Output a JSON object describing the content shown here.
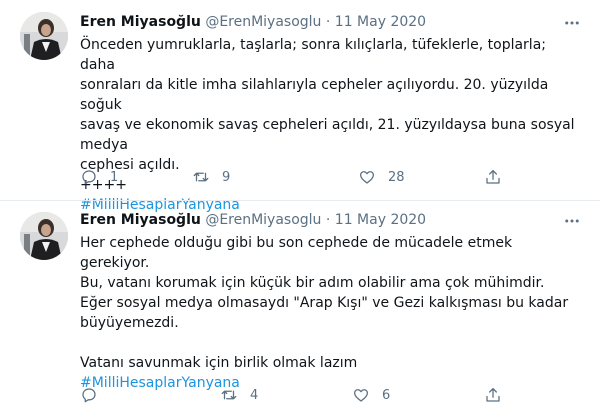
{
  "tweets": [
    {
      "display_name": "Eren Miyasoğlu",
      "handle": "@ErenMiyasoglu",
      "separator": "·",
      "date": "11 May 2020",
      "text": "Önceden yumruklarla, taşlarla; sonra kılıçlarla, tüfeklerle, toplarla; daha\nsonraları da kitle imha silahlarıyla cepheler açılıyordu. 20. yüzyılda soğuk\nsavaş ve ekonomik savaş cepheleri açıldı, 21. yüzyıldaysa buna sosyal medya\ncephesi açıldı.\n++++",
      "hashtag": "#MilliHesaplarYanyana",
      "reply_count": "1",
      "retweet_count": "9",
      "like_count": "28"
    },
    {
      "display_name": "Eren Miyasoğlu",
      "handle": "@ErenMiyasoglu",
      "separator": "·",
      "date": "11 May 2020",
      "text": "Her cephede olduğu gibi bu son cephede de mücadele etmek gerekiyor.\nBu, vatanı korumak için küçük bir adım olabilir ama çok mühimdir.\nEğer sosyal medya olmasaydı \"Arap Kışı\" ve Gezi kalkışması bu kadar\nbüyüyemezdi.\n\nVatanı savunmak için birlik olmak lazım",
      "hashtag": "#MilliHesaplarYanyana",
      "reply_count": "",
      "retweet_count": "4",
      "like_count": "6"
    }
  ],
  "icons": {
    "more": "ellipsis-icon",
    "reply": "reply-icon",
    "retweet": "retweet-icon",
    "like": "heart-icon",
    "share": "share-icon"
  },
  "colors": {
    "text": "#0f1419",
    "secondary": "#5b7083",
    "link": "#1b95e0",
    "divider": "#e6ecf0"
  }
}
